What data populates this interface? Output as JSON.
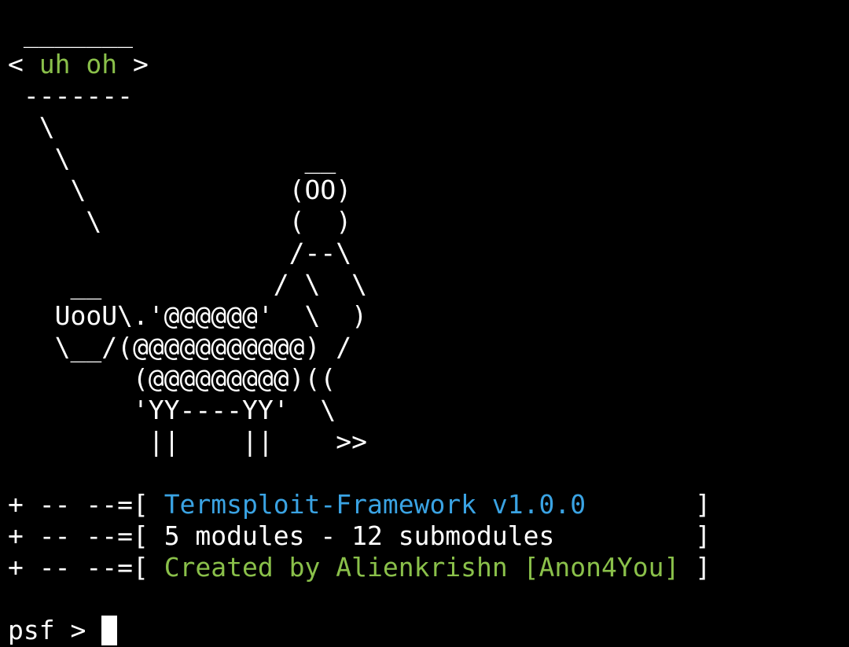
{
  "art": {
    "bubble_top": " _______",
    "bubble_left": "< ",
    "bubble_text": "uh oh",
    "bubble_right": " >",
    "bubble_bottom": " -------",
    "rows": [
      "  \\",
      "   \\               __",
      "    \\             (OO)",
      "     \\            (  )",
      "                  /--\\",
      "    __           / \\  \\",
      "   UooU\\.'@@@@@@'  \\  )",
      "   \\__/(@@@@@@@@@@@) /",
      "        (@@@@@@@@@)((",
      "        'YY----YY'  \\",
      "         ||    ||    >>"
    ]
  },
  "banner": {
    "prefix": "+ -- --=[ ",
    "line1": "Termsploit-Framework v1.0.0",
    "line1_pad": "       ]",
    "line2": "5 modules - 12 submodules",
    "line2_pad": "         ]",
    "line3": "Created by Alienkrishn [Anon4You]",
    "line3_pad": " ]"
  },
  "prompt": {
    "text": "psf > "
  },
  "colors": {
    "background": "#000000",
    "text": "#ffffff",
    "green": "#8ac04a",
    "blue": "#3aa3e3"
  }
}
